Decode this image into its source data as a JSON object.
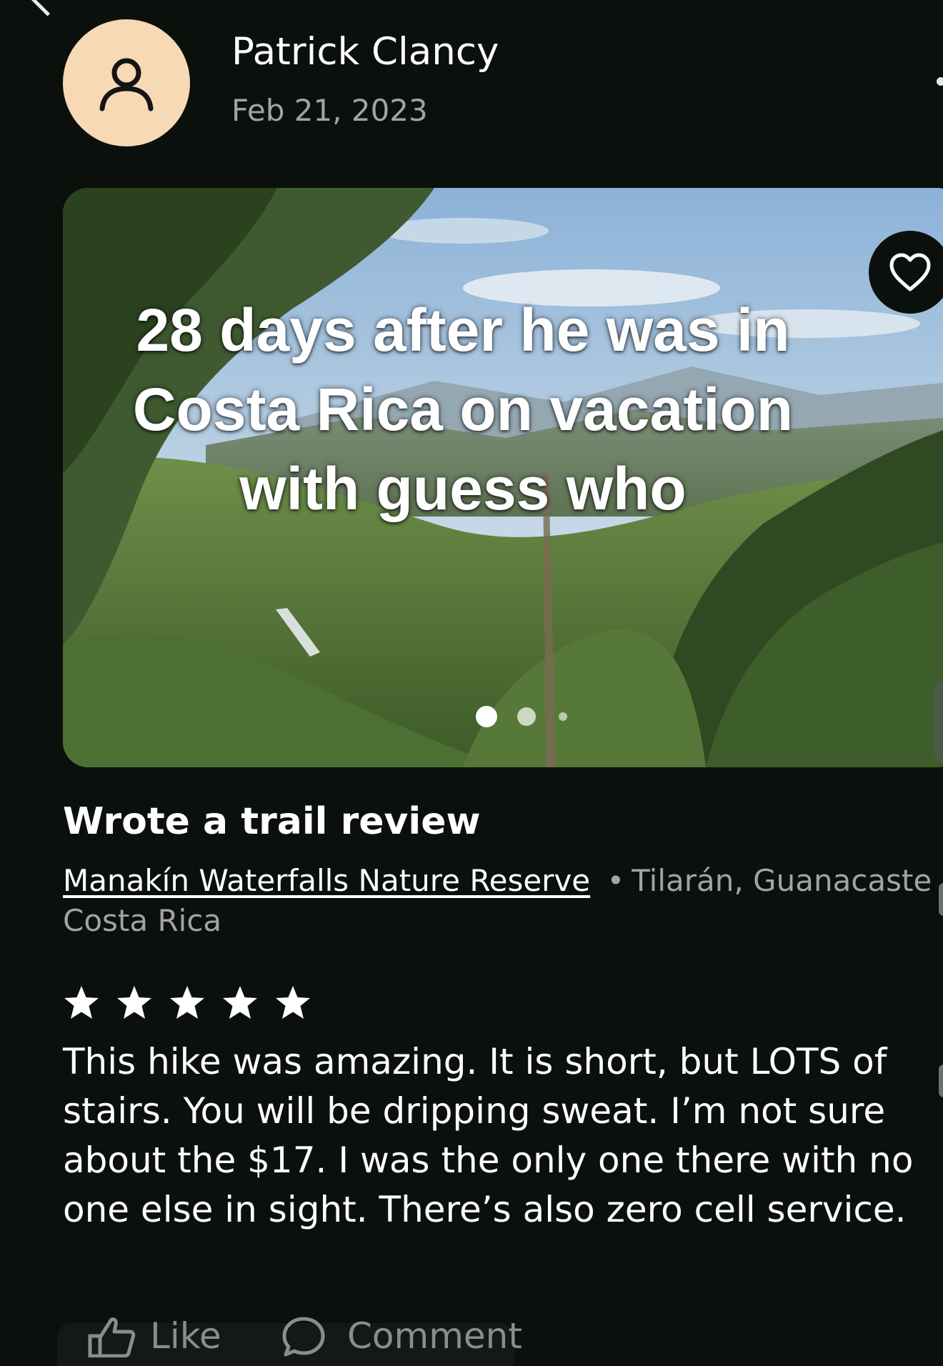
{
  "post": {
    "author_name": "Patrick Clancy",
    "date": "Feb 21, 2023",
    "avatar_icon": "person-outline-icon",
    "avatar_color": "#f8d9b5"
  },
  "media": {
    "caption_lines": [
      "28 days after he was in",
      "Costa Rica on vacation",
      "with guess who"
    ],
    "favorite_icon": "heart-outline-icon",
    "carousel_total": 3,
    "carousel_active_index": 0
  },
  "activity": {
    "title": "Wrote a trail review",
    "trail_name": "Manakín Waterfalls Nature Reserve",
    "separator": "•",
    "location_part1": "Tilarán, Guanacaste",
    "location_part2": "Costa Rica"
  },
  "review": {
    "rating": 5,
    "rating_max": 5,
    "star_color": "#ffffff",
    "text_lines": [
      "This hike was amazing. It is short, but LOTS of",
      "stairs. You will be dripping sweat. I’m not sure",
      "about the $17. I was the only one there with no",
      "one else in sight. There’s also zero cell service."
    ]
  },
  "actions": {
    "like_label": "Like",
    "comment_label": "Comment",
    "like_icon": "thumbs-up-icon",
    "comment_icon": "comment-bubble-icon"
  },
  "theme": {
    "background": "#0b100c",
    "primary_text": "#ffffff",
    "secondary_text": "#a3a3a3"
  }
}
